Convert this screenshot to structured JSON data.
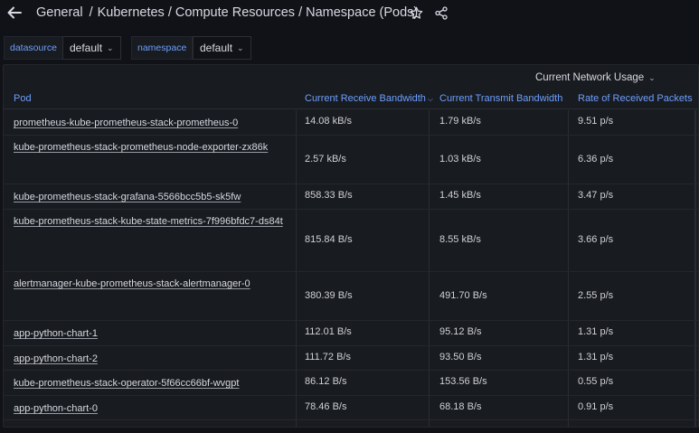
{
  "breadcrumb": {
    "folder": "General",
    "separator": "/",
    "title": "Kubernetes / Compute Resources / Namespace (Pods)"
  },
  "variables": [
    {
      "label": "datasource",
      "value": "default"
    },
    {
      "label": "namespace",
      "value": "default"
    }
  ],
  "panel": {
    "title": "Current Network Usage",
    "columns": [
      "Pod",
      "Current Receive Bandwidth",
      "Current Transmit Bandwidth",
      "Rate of Received Packets"
    ],
    "rows": [
      {
        "pod": "prometheus-kube-prometheus-stack-prometheus-0",
        "receive": "14.08 kB/s",
        "transmit": "1.79 kB/s",
        "rate": "9.51 p/s"
      },
      {
        "pod": "kube-prometheus-stack-prometheus-node-exporter-zx86k",
        "receive": "2.57 kB/s",
        "transmit": "1.03 kB/s",
        "rate": "6.36 p/s"
      },
      {
        "pod": "kube-prometheus-stack-grafana-5566bcc5b5-sk5fw",
        "receive": "858.33 B/s",
        "transmit": "1.45 kB/s",
        "rate": "3.47 p/s"
      },
      {
        "pod": "kube-prometheus-stack-kube-state-metrics-7f996bfdc7-ds84t",
        "receive": "815.84 B/s",
        "transmit": "8.55 kB/s",
        "rate": "3.66 p/s"
      },
      {
        "pod": "alertmanager-kube-prometheus-stack-alertmanager-0",
        "receive": "380.39 B/s",
        "transmit": "491.70 B/s",
        "rate": "2.55 p/s"
      },
      {
        "pod": "app-python-chart-1",
        "receive": "112.01 B/s",
        "transmit": "95.12 B/s",
        "rate": "1.31 p/s"
      },
      {
        "pod": "app-python-chart-2",
        "receive": "111.72 B/s",
        "transmit": "93.50 B/s",
        "rate": "1.31 p/s"
      },
      {
        "pod": "kube-prometheus-stack-operator-5f66cc66bf-wvgpt",
        "receive": "86.12 B/s",
        "transmit": "153.56 B/s",
        "rate": "0.55 p/s"
      },
      {
        "pod": "app-python-chart-0",
        "receive": "78.46 B/s",
        "transmit": "68.18 B/s",
        "rate": "0.91 p/s"
      }
    ]
  },
  "colors": {
    "background": "#111217",
    "panel": "#181b1f",
    "header_link": "#6e9fff",
    "text": "#d8d9e3"
  },
  "icons": [
    "arrow-left-icon",
    "star-icon",
    "share-icon",
    "chevron-down-icon"
  ]
}
